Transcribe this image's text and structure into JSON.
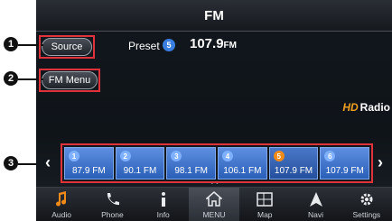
{
  "screen_title": "FM",
  "source_button": "Source",
  "fm_menu_button": "FM Menu",
  "preset_label": "Preset",
  "current_preset_number": "5",
  "current_frequency": "107.9",
  "current_band": "FM",
  "hd_logo": "HD",
  "hd_radio_label": "Radio",
  "callouts": [
    "1",
    "2",
    "3"
  ],
  "presets": [
    {
      "number": "1",
      "frequency": "87.9 FM"
    },
    {
      "number": "2",
      "frequency": "90.1 FM"
    },
    {
      "number": "3",
      "frequency": "98.1 FM"
    },
    {
      "number": "4",
      "frequency": "106.1 FM"
    },
    {
      "number": "5",
      "frequency": "107.9 FM"
    },
    {
      "number": "6",
      "frequency": "107.9 FM"
    }
  ],
  "active_preset_index": 4,
  "bottom_nav": [
    {
      "label": "Audio",
      "icon": "music-note-icon"
    },
    {
      "label": "Phone",
      "icon": "phone-icon"
    },
    {
      "label": "Info",
      "icon": "info-icon"
    },
    {
      "label": "MENU",
      "icon": "home-icon"
    },
    {
      "label": "Map",
      "icon": "map-icon"
    },
    {
      "label": "Navi",
      "icon": "navigation-arrow-icon"
    },
    {
      "label": "Settings",
      "icon": "gear-icon"
    }
  ],
  "colors": {
    "accent_orange": "#f08a18",
    "preset_blue": "#3a7ee0",
    "highlight_red": "#e0323a"
  }
}
